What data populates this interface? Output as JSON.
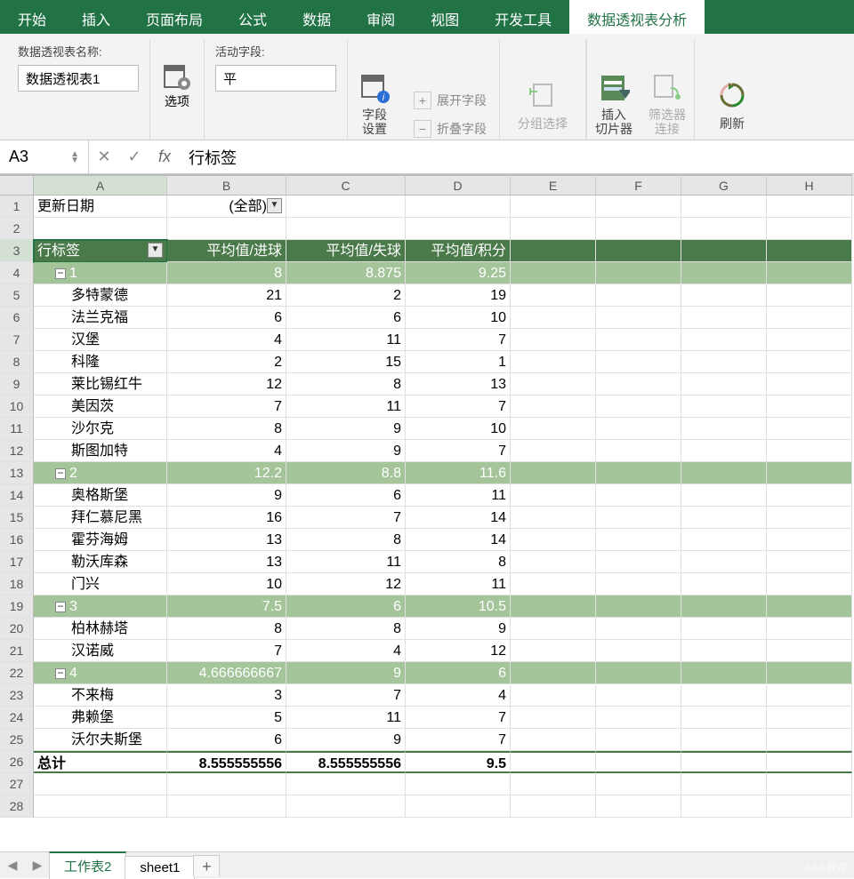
{
  "tabs": [
    "开始",
    "插入",
    "页面布局",
    "公式",
    "数据",
    "审阅",
    "视图",
    "开发工具",
    "数据透视表分析"
  ],
  "activeTab": 8,
  "ribbon": {
    "pivotNameLabel": "数据透视表名称:",
    "pivotNameValue": "数据透视表1",
    "optionsLabel": "选项",
    "activeFieldLabel": "活动字段:",
    "activeFieldValue": "平",
    "fieldSettings": "字段\n设置",
    "expandField": "展开字段",
    "collapseField": "折叠字段",
    "groupSelect": "分组选择",
    "insertSlicer": "插入\n切片器",
    "filterConn": "筛选器\n连接",
    "refresh": "刷新"
  },
  "nameBox": "A3",
  "formula": "行标签",
  "columns": [
    "A",
    "B",
    "C",
    "D",
    "E",
    "F",
    "G",
    "H"
  ],
  "activeCol": 0,
  "activeRow": 3,
  "rows": [
    {
      "n": 1,
      "a": "更新日期",
      "b": "(全部)",
      "bfilter": true
    },
    {
      "n": 2
    },
    {
      "n": 3,
      "hdr": true,
      "a": "行标签",
      "afilter": true,
      "b": "平均值/进球",
      "c": "平均值/失球",
      "d": "平均值/积分",
      "sel": true
    },
    {
      "n": 4,
      "sub": true,
      "collapse": true,
      "a": "1",
      "b": "8",
      "c": "8.875",
      "d": "9.25"
    },
    {
      "n": 5,
      "indent": 2,
      "a": "多特蒙德",
      "b": "21",
      "c": "2",
      "d": "19"
    },
    {
      "n": 6,
      "indent": 2,
      "a": "法兰克福",
      "b": "6",
      "c": "6",
      "d": "10"
    },
    {
      "n": 7,
      "indent": 2,
      "a": "汉堡",
      "b": "4",
      "c": "11",
      "d": "7"
    },
    {
      "n": 8,
      "indent": 2,
      "a": "科隆",
      "b": "2",
      "c": "15",
      "d": "1"
    },
    {
      "n": 9,
      "indent": 2,
      "a": "莱比锡红牛",
      "b": "12",
      "c": "8",
      "d": "13"
    },
    {
      "n": 10,
      "indent": 2,
      "a": "美因茨",
      "b": "7",
      "c": "11",
      "d": "7"
    },
    {
      "n": 11,
      "indent": 2,
      "a": "沙尔克",
      "b": "8",
      "c": "9",
      "d": "10"
    },
    {
      "n": 12,
      "indent": 2,
      "a": "斯图加特",
      "b": "4",
      "c": "9",
      "d": "7"
    },
    {
      "n": 13,
      "sub": true,
      "collapse": true,
      "a": "2",
      "b": "12.2",
      "c": "8.8",
      "d": "11.6"
    },
    {
      "n": 14,
      "indent": 2,
      "a": "奥格斯堡",
      "b": "9",
      "c": "6",
      "d": "11"
    },
    {
      "n": 15,
      "indent": 2,
      "a": "拜仁慕尼黑",
      "b": "16",
      "c": "7",
      "d": "14"
    },
    {
      "n": 16,
      "indent": 2,
      "a": "霍芬海姆",
      "b": "13",
      "c": "8",
      "d": "14"
    },
    {
      "n": 17,
      "indent": 2,
      "a": "勒沃库森",
      "b": "13",
      "c": "11",
      "d": "8"
    },
    {
      "n": 18,
      "indent": 2,
      "a": "门兴",
      "b": "10",
      "c": "12",
      "d": "11"
    },
    {
      "n": 19,
      "sub": true,
      "collapse": true,
      "a": "3",
      "b": "7.5",
      "c": "6",
      "d": "10.5"
    },
    {
      "n": 20,
      "indent": 2,
      "a": "柏林赫塔",
      "b": "8",
      "c": "8",
      "d": "9"
    },
    {
      "n": 21,
      "indent": 2,
      "a": "汉诺威",
      "b": "7",
      "c": "4",
      "d": "12"
    },
    {
      "n": 22,
      "sub": true,
      "collapse": true,
      "a": "4",
      "b": "4.666666667",
      "c": "9",
      "d": "6"
    },
    {
      "n": 23,
      "indent": 2,
      "a": "不来梅",
      "b": "3",
      "c": "7",
      "d": "4"
    },
    {
      "n": 24,
      "indent": 2,
      "a": "弗赖堡",
      "b": "5",
      "c": "11",
      "d": "7"
    },
    {
      "n": 25,
      "indent": 2,
      "a": "沃尔夫斯堡",
      "b": "6",
      "c": "9",
      "d": "7"
    },
    {
      "n": 26,
      "total": true,
      "a": "总计",
      "b": "8.555555556",
      "c": "8.555555556",
      "d": "9.5"
    },
    {
      "n": 27
    },
    {
      "n": 28
    }
  ],
  "sheets": {
    "tabs": [
      "工作表2",
      "sheet1"
    ],
    "active": 0
  },
  "watermark": "AAA教育"
}
